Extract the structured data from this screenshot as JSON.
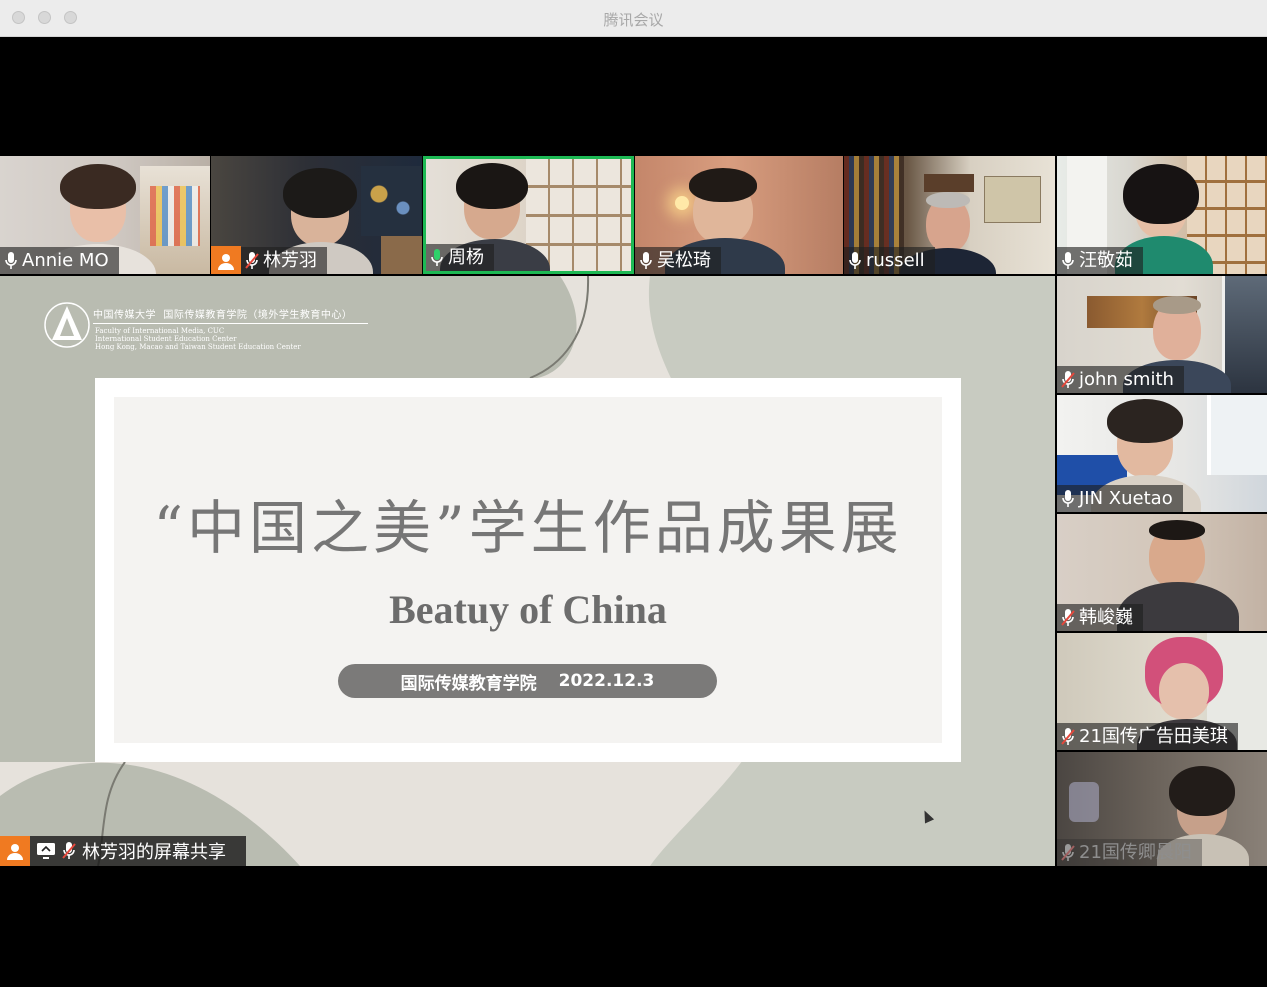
{
  "window": {
    "title": "腾讯会议"
  },
  "participants_top": [
    {
      "name": "Annie MO",
      "mic": "on"
    },
    {
      "name": "林芳羽",
      "mic": "muted",
      "avatar_badge": true
    },
    {
      "name": "周杨",
      "mic": "on",
      "speaking": true
    },
    {
      "name": "吴松琦",
      "mic": "on"
    },
    {
      "name": "russell",
      "mic": "on"
    },
    {
      "name": "汪敬茹",
      "mic": "on"
    }
  ],
  "participants_side": [
    {
      "name": "john smith",
      "mic": "muted"
    },
    {
      "name": "JIN Xuetao",
      "mic": "on"
    },
    {
      "name": "韩峻巍",
      "mic": "muted"
    },
    {
      "name": "21国传广告田美琪",
      "mic": "muted"
    },
    {
      "name": "21国传卿晨阳",
      "mic": "muted"
    }
  ],
  "slide": {
    "logo_cn": "中国传媒大学",
    "logo_title": "国际传媒教育学院（境外学生教育中心）",
    "logo_en": [
      "Faculty of International Media, CUC",
      "International Student Education Center",
      "Hong Kong, Macao and Taiwan Student Education Center"
    ],
    "title": "“中国之美”学生作品成果展",
    "subtitle": "Beatuy of China",
    "org": "国际传媒教育学院",
    "date": "2022.12.3"
  },
  "share_bar": {
    "label": "林芳羽的屏幕共享"
  },
  "colors": {
    "speaking_border": "#1db954",
    "avatar_badge": "#f07a21",
    "slide_bg": "#e6e2dc",
    "slide_blob": "#b9bcb1"
  }
}
